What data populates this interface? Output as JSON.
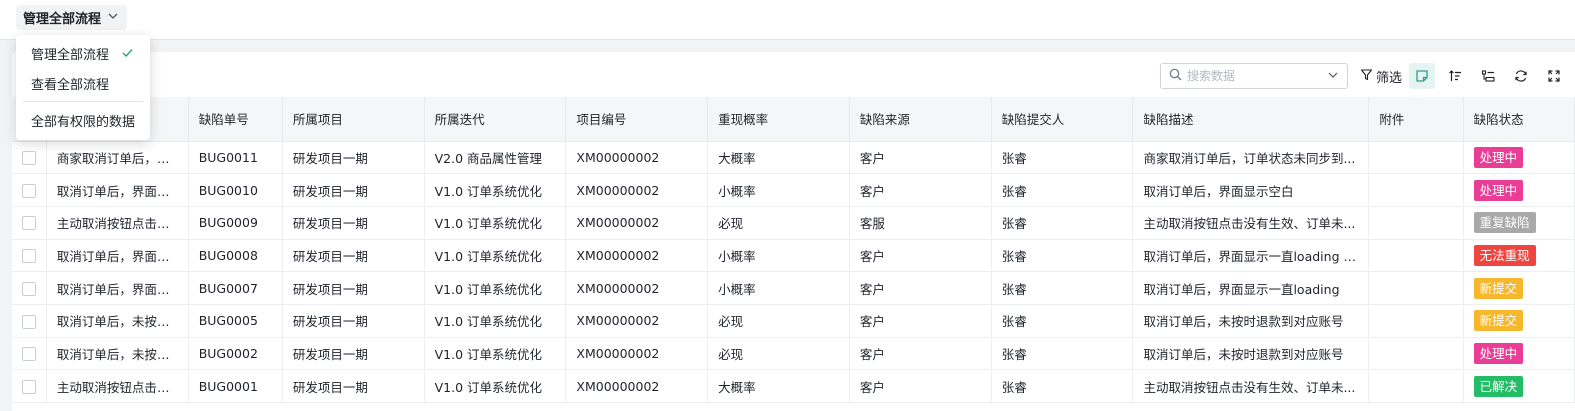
{
  "scope": {
    "current_label": "管理全部流程",
    "options": [
      {
        "label": "管理全部流程",
        "selected": true
      },
      {
        "label": "查看全部流程",
        "selected": false
      },
      {
        "label": "全部有权限的数据",
        "selected": false
      }
    ]
  },
  "toolbar": {
    "search_placeholder": "搜索数据",
    "filter_label": "筛选",
    "icons": [
      "search-icon",
      "chevron-down-icon",
      "filter-icon",
      "note-icon",
      "sort-icon",
      "group-icon",
      "refresh-icon",
      "fullscreen-icon"
    ]
  },
  "colors": {
    "accent": "#2aa288",
    "processing": "#ea3d95",
    "duplicate": "#a9a9a9",
    "cannot_reproduce": "#f0453f",
    "new": "#f7b72d",
    "resolved": "#23bd66"
  },
  "table": {
    "columns": [
      "缺陷单号",
      "所属项目",
      "所属迭代",
      "项目编号",
      "重现概率",
      "缺陷来源",
      "缺陷提交人",
      "缺陷描述",
      "附件",
      "缺陷状态"
    ],
    "rows": [
      {
        "title": "商家取消订单后，订...",
        "id": "BUG0011",
        "project": "研发项目一期",
        "iteration": "V2.0 商品属性管理",
        "code": "XM00000002",
        "prob": "大概率",
        "source": "客户",
        "submitter": "张睿",
        "desc": "商家取消订单后，订单状态未同步到...",
        "attach": "",
        "status": "处理中",
        "status_color": "#ea3d95"
      },
      {
        "title": "取消订单后，界面显...",
        "id": "BUG0010",
        "project": "研发项目一期",
        "iteration": "V1.0 订单系统优化",
        "code": "XM00000002",
        "prob": "小概率",
        "source": "客户",
        "submitter": "张睿",
        "desc": "取消订单后，界面显示空白",
        "attach": "",
        "status": "处理中",
        "status_color": "#ea3d95"
      },
      {
        "title": "主动取消按钮点击没...",
        "id": "BUG0009",
        "project": "研发项目一期",
        "iteration": "V1.0 订单系统优化",
        "code": "XM00000002",
        "prob": "必现",
        "source": "客服",
        "submitter": "张睿",
        "desc": "主动取消按钮点击没有生效、订单未...",
        "attach": "",
        "status": "重复缺陷",
        "status_color": "#a9a9a9"
      },
      {
        "title": "取消订单后，界面显...",
        "id": "BUG0008",
        "project": "研发项目一期",
        "iteration": "V1.0 订单系统优化",
        "code": "XM00000002",
        "prob": "小概率",
        "source": "客户",
        "submitter": "张睿",
        "desc": "取消订单后，界面显示一直loading 重...",
        "attach": "",
        "status": "无法重现",
        "status_color": "#f0453f"
      },
      {
        "title": "取消订单后，界面显...",
        "id": "BUG0007",
        "project": "研发项目一期",
        "iteration": "V1.0 订单系统优化",
        "code": "XM00000002",
        "prob": "小概率",
        "source": "客户",
        "submitter": "张睿",
        "desc": "取消订单后，界面显示一直loading",
        "attach": "",
        "status": "新提交",
        "status_color": "#f7b72d"
      },
      {
        "title": "取消订单后，未按时...",
        "id": "BUG0005",
        "project": "研发项目一期",
        "iteration": "V1.0 订单系统优化",
        "code": "XM00000002",
        "prob": "必现",
        "source": "客户",
        "submitter": "张睿",
        "desc": "取消订单后，未按时退款到对应账号",
        "attach": "",
        "status": "新提交",
        "status_color": "#f7b72d"
      },
      {
        "title": "取消订单后，未按时...",
        "id": "BUG0002",
        "project": "研发项目一期",
        "iteration": "V1.0 订单系统优化",
        "code": "XM00000002",
        "prob": "必现",
        "source": "客户",
        "submitter": "张睿",
        "desc": "取消订单后，未按时退款到对应账号",
        "attach": "",
        "status": "处理中",
        "status_color": "#ea3d95"
      },
      {
        "title": "主动取消按钮点击没...",
        "id": "BUG0001",
        "project": "研发项目一期",
        "iteration": "V1.0 订单系统优化",
        "code": "XM00000002",
        "prob": "大概率",
        "source": "客户",
        "submitter": "张睿",
        "desc": "主动取消按钮点击没有生效、订单未...",
        "attach": "",
        "status": "已解决",
        "status_color": "#23bd66"
      }
    ]
  }
}
